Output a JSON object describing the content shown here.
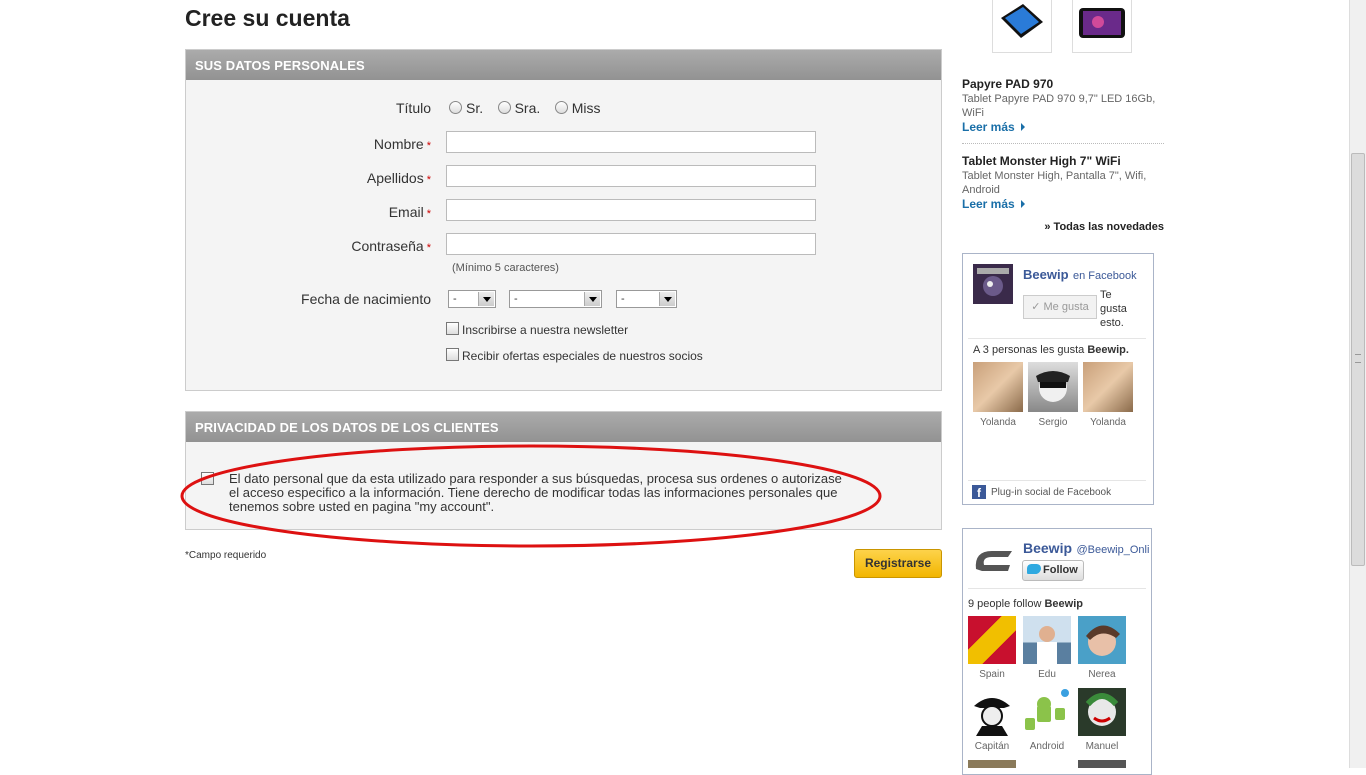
{
  "page": {
    "title": "Cree su cuenta"
  },
  "personal": {
    "heading": "SUS DATOS PERSONALES",
    "title_label": "Título",
    "title_options": [
      "Sr.",
      "Sra.",
      "Miss"
    ],
    "first_name_label": "Nombre",
    "last_name_label": "Apellidos",
    "email_label": "Email",
    "password_label": "Contraseña",
    "password_hint": "(Mínimo 5 caracteres)",
    "birthdate_label": "Fecha de nacimiento",
    "day_value": "-",
    "month_value": "-",
    "year_value": "-",
    "newsletter_label": "Inscribirse a nuestra newsletter",
    "offers_label": "Recibir ofertas especiales de nuestros socios",
    "required_mark": "*"
  },
  "privacy": {
    "heading": "PRIVACIDAD DE LOS DATOS DE LOS CLIENTES",
    "text": "El dato personal que da esta utilizado para responder a sus búsquedas, procesa sus ordenes o autorizase el acceso especifico a la información. Tiene derecho de modificar todas las informaciones personales que tenemos sobre usted en pagina \"my account\"."
  },
  "footer": {
    "required_note": "*Campo requerido",
    "register_label": "Registrarse"
  },
  "sidebar": {
    "products": [
      {
        "title": "Papyre PAD 970",
        "desc": "Tablet Papyre PAD 970 9,7\" LED 16Gb, WiFi",
        "more": "Leer más"
      },
      {
        "title": "Tablet Monster High 7\" WiFi",
        "desc": "Tablet Monster High, Pantalla 7\", Wifi, Android",
        "more": "Leer más"
      }
    ],
    "all_news": "» Todas las novedades",
    "facebook": {
      "page_name": "Beewip",
      "en": "en Facebook",
      "like_button": "Me gusta",
      "like_text": "Te gusta esto.",
      "count_prefix": "A 3 personas les gusta",
      "count_name": "Beewip.",
      "friends": [
        "Yolanda",
        "Sergio",
        "Yolanda"
      ],
      "plugin_label": "Plug-in social de Facebook"
    },
    "twitter": {
      "name": "Beewip",
      "handle": "@Beewip_Online",
      "follow_button": "Follow",
      "followers_prefix": "9 people follow",
      "followers_name": "Beewip",
      "followers": [
        "Spain",
        "Edu",
        "Nerea",
        "Capitán",
        "Android",
        "Manuel"
      ]
    }
  },
  "colors": {
    "panel_header": "#9c9c9c",
    "required": "#cc0000",
    "register_button": "#f5bf1c",
    "link_blue": "#1a6fa8",
    "facebook_blue": "#3b5998",
    "annotation_red": "#dd1111"
  }
}
